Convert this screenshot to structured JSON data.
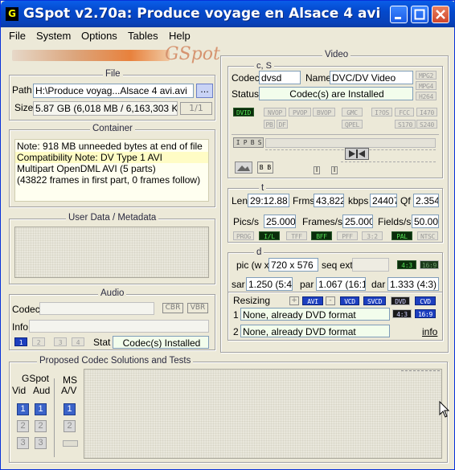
{
  "window": {
    "title": "GSpot v2.70a: Produce voyage en Alsace 4 avi"
  },
  "menu": [
    "File",
    "System",
    "Options",
    "Tables",
    "Help"
  ],
  "logo_text": "GSpot",
  "file": {
    "title": "File",
    "path_label": "Path",
    "path_value": "H:\\Produce voyag...Alsace 4 avi.avi",
    "browse_label": "...",
    "size_label": "Size",
    "size_value": "5.87 GB (6,018 MB / 6,163,303 KB",
    "part_label": "1/1"
  },
  "container": {
    "title": "Container",
    "lines": [
      "Note: 918 MB unneeded bytes at end of file",
      "Compatibility Note: DV Type 1 AVI",
      "Multipart OpenDML AVI (5 parts)",
      "(43822 frames in first part, 0 frames follow)"
    ]
  },
  "userdata": {
    "title": "User Data / Metadata"
  },
  "audio": {
    "title": "Audio",
    "codec_label": "Codec",
    "info_label": "Info",
    "cbr": "CBR",
    "vbr": "VBR",
    "streams": [
      "1",
      "2",
      "3",
      "4"
    ],
    "stat_label": "Stat",
    "stat_value": "Codec(s) Installed"
  },
  "proposed": {
    "title": "Proposed Codec Solutions and Tests",
    "gspot_label": "GSpot",
    "vid_label": "Vid",
    "aud_label": "Aud",
    "ms_label": "MS",
    "av_label": "A/V",
    "rows": [
      "1",
      "2",
      "3"
    ]
  },
  "video": {
    "title": "Video",
    "cs": {
      "title": "c, S",
      "codec_label": "Codec",
      "codec_value": "dvsd",
      "name_label": "Name",
      "name_value": "DVC/DV Video",
      "status_label": "Status",
      "status_value": "Codec(s) are Installed",
      "side_tags": [
        "MPG2",
        "MPG4",
        "H264"
      ]
    },
    "tags_row1": [
      "DVID",
      "NVOP",
      "PVOP",
      "BVOP",
      "GMC",
      "I?OS",
      "FCC",
      "I470"
    ],
    "tags_row2": [
      "PB",
      "DF",
      "QPEL",
      "S170",
      "S240"
    ],
    "frame_tags": [
      "I",
      "P",
      "B",
      "S"
    ],
    "t": {
      "title": "t",
      "len_label": "Len",
      "len_value": "29:12.88",
      "frms_label": "Frms",
      "frms_value": "43,822",
      "kbps_label": "kbps",
      "kbps_value": "24407",
      "qf_label": "Qf",
      "qf_value": "2.354",
      "pics_label": "Pics/s",
      "pics_value": "25.000",
      "frames_label": "Frames/s",
      "frames_value": "25.000",
      "fields_label": "Fields/s",
      "fields_value": "50.00",
      "flags": [
        "PROG",
        "I/L",
        "TFF",
        "BFF",
        "PFF",
        "3:2",
        "PAL",
        "NTSC"
      ]
    },
    "d": {
      "title": "d",
      "pic_label": "pic (w x",
      "pic_value": "720 x 576",
      "seqext_label": "seq ext",
      "ar43": "4:3",
      "ar169": "16:9",
      "sar_label": "sar",
      "sar_value": "1.250 (5:4)",
      "par_label": "par",
      "par_value": "1.067 (16:1",
      "dar_label": "dar",
      "dar_value": "1.333 (4:3)"
    },
    "resizing": {
      "label": "Resizing",
      "plus": "+",
      "minus": "-",
      "targets": [
        "AVI",
        "VCD",
        "SVCD",
        "DVD",
        "CVD"
      ],
      "row1_num": "1",
      "row1_text": "None, already DVD format",
      "row2_num": "2",
      "row2_text": "None, already DVD format",
      "ar43": "4:3",
      "ar169": "16:9",
      "info_link": "info"
    }
  }
}
